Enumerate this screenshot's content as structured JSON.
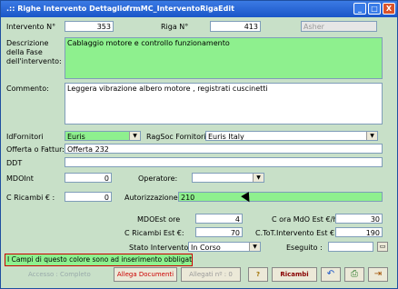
{
  "window": {
    "title_left": ".:: Righe Intervento Dettaglio ::..",
    "title_right": "frmMC_InterventoRigaEdit",
    "min": "_",
    "max": "□",
    "close": "X"
  },
  "header": {
    "intervento_label": "Intervento N°",
    "intervento_value": "353",
    "riga_label": "Riga N°",
    "riga_value": "413",
    "user_placeholder": "Asher"
  },
  "descrizione": {
    "label": "Descrizione\ndella Fase\ndell'intervento:",
    "value": "Cablaggio motore e controllo funzionamento"
  },
  "commento": {
    "label": "Commento:",
    "value": "Leggera vibrazione albero motore , registrati cuscinetti"
  },
  "fornitori": {
    "id_label": "IdFornitori",
    "id_value": "Euris",
    "ragsoc_label": "RagSoc Fornitori",
    "ragsoc_value": "Euris Italy"
  },
  "offerta": {
    "label": "Offerta o Fattur:",
    "value": "Offerta  232"
  },
  "ddt": {
    "label": "DDT",
    "value": ""
  },
  "mdoint": {
    "label": "MDOInt",
    "value": "0",
    "operatore_label": "Operatore:",
    "operatore_value": ""
  },
  "ricambi": {
    "label": "C  Ricambi € :",
    "value": "0",
    "autorizzazione_label": "Autorizzazione:",
    "autorizzazione_value": "210"
  },
  "totals": {
    "mdoest_label": "MDOEst ore",
    "mdoest_value": "4",
    "cora_label": "C ora MdO Est  €/h:",
    "cora_value": "30",
    "cricambi_label": "C  Ricambi Est €:",
    "cricambi_value": "70",
    "ctot_label": "C.ToT.Intervento Est €:",
    "ctot_value": "190"
  },
  "stato": {
    "label": "Stato Intervento:",
    "value": "In Corso",
    "eseguito_label": "Eseguito :",
    "eseguito_value": ""
  },
  "notice": "I Campi di questo colore sono ad inserimento obbligatorio",
  "footer": {
    "accesso": "Accesso : Completo",
    "allega_documenti": "Allega Documenti",
    "allegati": "Allegati nº : 0",
    "help": "?",
    "ricambi": "Ricambi"
  },
  "colors": {
    "required": "#8ef08e",
    "background": "#c8e0c8",
    "titlebar": "#1a56c8"
  }
}
